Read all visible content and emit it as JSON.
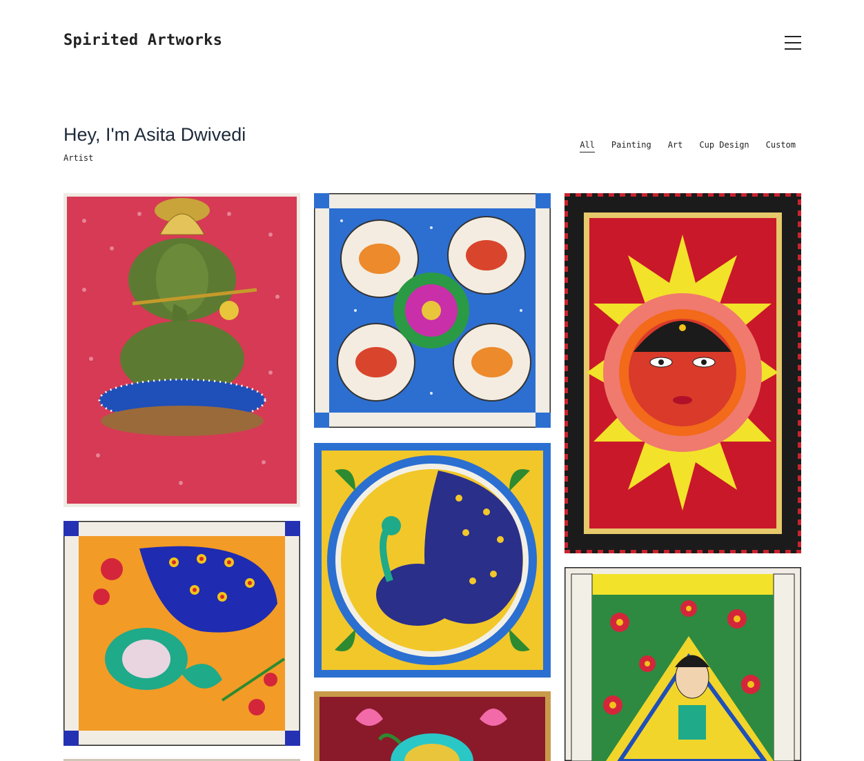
{
  "header": {
    "site_title": "Spirited Artworks",
    "menu_icon": "hamburger-menu-icon"
  },
  "intro": {
    "title": "Hey, I'm Asita Dwivedi",
    "subtitle": "Artist"
  },
  "filters": [
    {
      "label": "All",
      "active": true
    },
    {
      "label": "Painting",
      "active": false
    },
    {
      "label": "Art",
      "active": false
    },
    {
      "label": "Cup Design",
      "active": false
    },
    {
      "label": "Custom",
      "active": false
    }
  ],
  "gallery": [
    {
      "subject": "ganesha-painting"
    },
    {
      "subject": "fish-lotus-painting"
    },
    {
      "subject": "sun-face-painting"
    },
    {
      "subject": "peacock-flowers-painting"
    },
    {
      "subject": "peacock-circle-painting"
    },
    {
      "subject": "madhubani-woman-painting"
    },
    {
      "subject": "lotus-tray-painting"
    }
  ]
}
